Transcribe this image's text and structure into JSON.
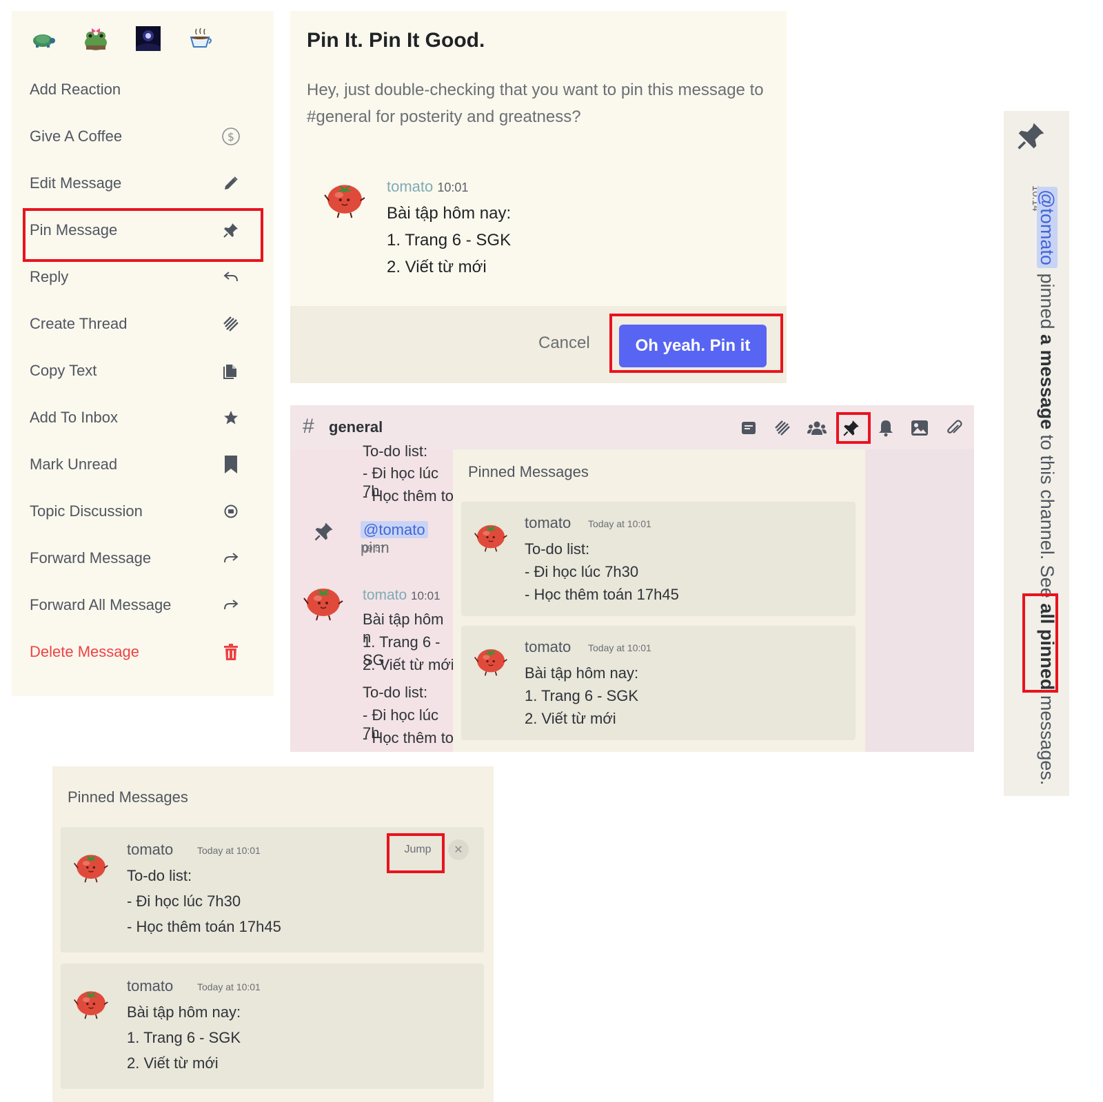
{
  "context_menu": {
    "reactions": [
      "turtle-emoji",
      "frog-with-bow-emoji",
      "night-sky-emoji",
      "hot-coffee-emoji"
    ],
    "items": [
      {
        "label": "Add Reaction",
        "icon": "none"
      },
      {
        "label": "Give A Coffee",
        "icon": "dollar-coin-icon"
      },
      {
        "label": "Edit Message",
        "icon": "pencil-icon"
      },
      {
        "label": "Pin Message",
        "icon": "pin-icon"
      },
      {
        "label": "Reply",
        "icon": "reply-arrow-icon"
      },
      {
        "label": "Create Thread",
        "icon": "thread-icon"
      },
      {
        "label": "Copy Text",
        "icon": "copy-icon"
      },
      {
        "label": "Add To Inbox",
        "icon": "star-icon"
      },
      {
        "label": "Mark Unread",
        "icon": "bookmark-icon"
      },
      {
        "label": "Topic Discussion",
        "icon": "topic-icon"
      },
      {
        "label": "Forward Message",
        "icon": "forward-arrow-icon"
      },
      {
        "label": "Forward All Message",
        "icon": "forward-arrow-icon"
      },
      {
        "label": "Delete Message",
        "icon": "trash-icon"
      }
    ],
    "danger_color": "#ed4245"
  },
  "pin_dialog": {
    "title": "Pin It. Pin It Good.",
    "description": "Hey, just double-checking that you want to pin this message to #general for posterity and greatness?",
    "message": {
      "username": "tomato",
      "time": "10:01",
      "lines": [
        "Bài tập hôm nay:",
        "1. Trang 6 - SGK",
        "2. Viết từ mới"
      ]
    },
    "cancel_label": "Cancel",
    "confirm_label": "Oh yeah. Pin it",
    "confirm_color": "#5865f2"
  },
  "channel": {
    "hash": "#",
    "name": "general",
    "toolbar_icons": [
      "threads-list-icon",
      "thread-icon",
      "members-icon",
      "pin-icon",
      "bell-icon",
      "image-icon",
      "paperclip-icon"
    ],
    "background_lines": {
      "top": [
        "To-do list:",
        "- Đi học lúc 7h",
        "- Học thêm to"
      ],
      "system_mention": "@tomato",
      "system_suffix": " pinn",
      "system_time": "09:57",
      "message_username": "tomato",
      "message_time": "10:01",
      "message_lines": [
        "Bài tập hôm n",
        "1. Trang 6 - SG",
        "2. Viết từ mới",
        "To-do list:",
        "- Đi học lúc 7h",
        "- Học thêm to"
      ]
    },
    "pinned_popout": {
      "title": "Pinned Messages",
      "messages": [
        {
          "username": "tomato",
          "time": "Today at 10:01",
          "lines": [
            "To-do list:",
            "- Đi học lúc 7h30",
            "- Học thêm toán 17h45"
          ]
        },
        {
          "username": "tomato",
          "time": "Today at 10:01",
          "lines": [
            "Bài tập hôm nay:",
            "1. Trang 6 - SGK",
            "2. Viết từ mới"
          ]
        }
      ]
    }
  },
  "system_message": {
    "time": "10:14",
    "mention": "@tomato",
    "text_1": " pinned ",
    "bold_1": "a message",
    "text_2": " to this channel. See ",
    "bold_2": "all pinned",
    "text_3": " messages."
  },
  "pinned_messages": {
    "title": "Pinned Messages",
    "jump_label": "Jump",
    "close_label": "✕",
    "messages": [
      {
        "username": "tomato",
        "time": "Today at 10:01",
        "lines": [
          "To-do list:",
          "- Đi học lúc 7h30",
          "- Học thêm toán 17h45"
        ]
      },
      {
        "username": "tomato",
        "time": "Today at 10:01",
        "lines": [
          "Bài tập hôm nay:",
          "1. Trang 6 - SGK",
          "2. Viết từ mới"
        ]
      }
    ]
  },
  "highlight_color": "#e8131f"
}
